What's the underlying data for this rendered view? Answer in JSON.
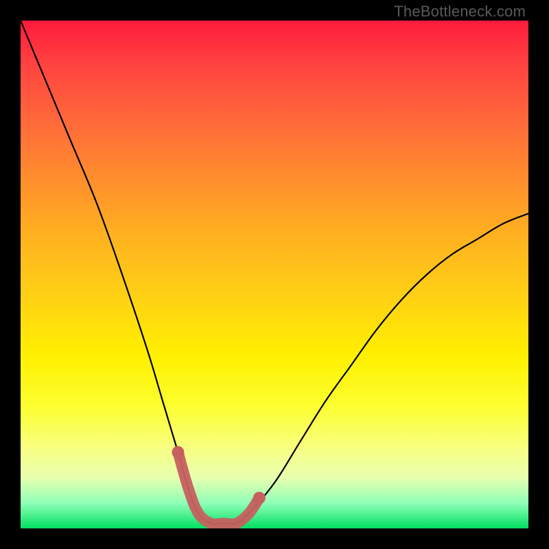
{
  "watermark": "TheBottleneck.com",
  "chart_data": {
    "type": "line",
    "title": "",
    "xlabel": "",
    "ylabel": "",
    "xlim": [
      0,
      100
    ],
    "ylim": [
      0,
      100
    ],
    "grid": false,
    "legend": false,
    "annotations": [],
    "background_gradient": {
      "top": "#ff1a3c",
      "mid": "#fff000",
      "bottom": "#00e060"
    },
    "series": [
      {
        "name": "main-curve",
        "color": "#000000",
        "x": [
          0,
          5,
          10,
          15,
          20,
          25,
          28,
          31,
          33,
          35,
          37.5,
          40,
          42.5,
          45,
          50,
          55,
          60,
          65,
          70,
          75,
          80,
          85,
          90,
          95,
          100
        ],
        "y": [
          100,
          88,
          76,
          64,
          50,
          35,
          25,
          15,
          8,
          3,
          1,
          1,
          1,
          3,
          9,
          17,
          25,
          32,
          39,
          45,
          50,
          54,
          57,
          60,
          62
        ]
      },
      {
        "name": "highlight-band",
        "color": "#c66060",
        "x": [
          31,
          33,
          35,
          37.5,
          40,
          42.5,
          45,
          47
        ],
        "y": [
          15,
          8,
          3,
          1,
          1,
          1,
          3,
          6
        ]
      }
    ]
  }
}
